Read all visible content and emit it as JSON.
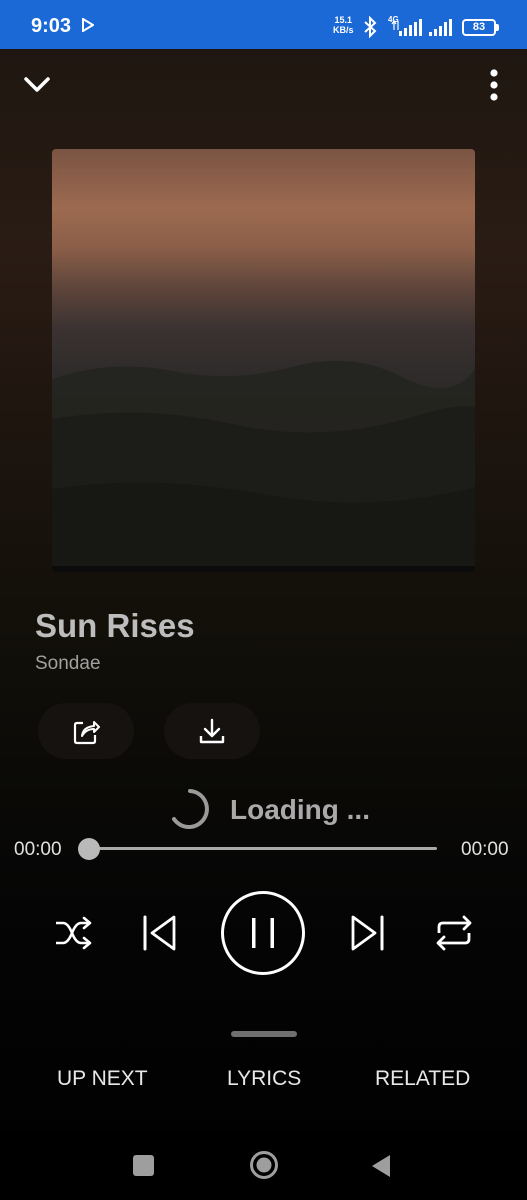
{
  "status_bar": {
    "time": "9:03",
    "net_speed_value": "15.1",
    "net_speed_unit": "KB/s",
    "network_type": "4G",
    "battery": "83",
    "icons": [
      "play-notification-icon",
      "bluetooth-icon",
      "signal-icon",
      "signal-icon",
      "battery-icon"
    ],
    "background": "#1a69d6"
  },
  "header": {
    "collapse_icon": "chevron-down-icon",
    "menu_icon": "more-vertical-icon"
  },
  "track": {
    "title": "Sun Rises",
    "artist": "Sondae"
  },
  "actions": {
    "share_icon": "share-icon",
    "download_icon": "download-icon"
  },
  "loading": {
    "text": "Loading ..."
  },
  "progress": {
    "current_time": "00:00",
    "total_time": "00:00",
    "fraction": 0
  },
  "controls": {
    "shuffle_icon": "shuffle-icon",
    "previous_icon": "skip-previous-icon",
    "pause_icon": "pause-icon",
    "next_icon": "skip-next-icon",
    "repeat_icon": "repeat-icon"
  },
  "tabs": [
    {
      "label": "UP NEXT"
    },
    {
      "label": "LYRICS"
    },
    {
      "label": "RELATED"
    }
  ],
  "nav": {
    "recents_icon": "square-icon",
    "home_icon": "circle-icon",
    "back_icon": "triangle-back-icon"
  }
}
